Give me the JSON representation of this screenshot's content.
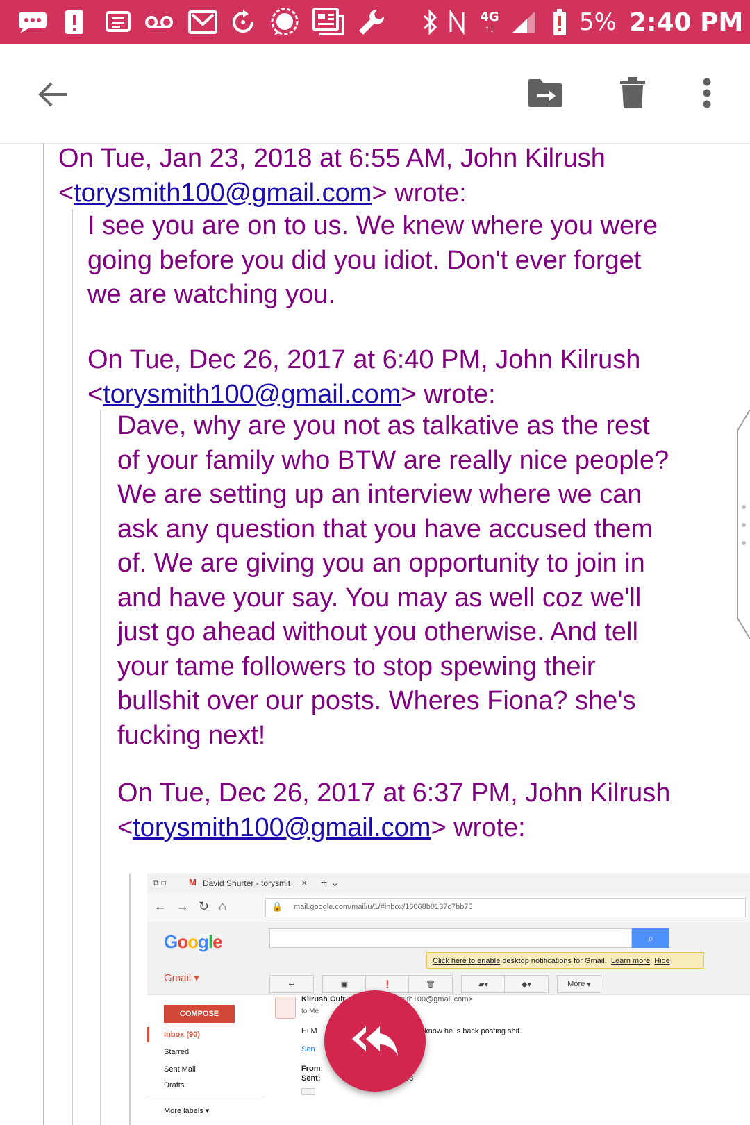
{
  "status_bar": {
    "battery_percent": "5%",
    "time": "2:40 PM",
    "network": "4G",
    "network_sub": "LTE",
    "background_color": "#d2335c",
    "left_icons": [
      "chat-bubble-icon",
      "alert-icon",
      "message-icon",
      "voicemail-icon",
      "gmail-icon",
      "sync-icon",
      "signal-app-icon",
      "news-icon",
      "wrench-icon"
    ],
    "right_icons": [
      "bluetooth-icon",
      "nfc-icon",
      "network-4g-icon",
      "cell-signal-icon",
      "battery-alert-icon"
    ]
  },
  "app_bar": {
    "actions": [
      "back-arrow-icon",
      "move-to-folder-icon",
      "delete-icon",
      "more-vert-icon"
    ]
  },
  "message": {
    "text_color": "#800080",
    "link_color": "#1a0dab",
    "q1": {
      "line1": "On Tue, Jan 23, 2018 at 6:55 AM, John Kilrush",
      "email": "torysmith100@gmail.com",
      "wrote": "wrote:"
    },
    "q1_body": {
      "line1": "I see you are on to us. We knew where you were",
      "line2": "going before you did you idiot. Don't ever forget",
      "line3": "we are watching you."
    },
    "q2": {
      "line1": "On Tue, Dec 26, 2017 at 6:40 PM, John Kilrush",
      "email": "torysmith100@gmail.com",
      "wrote": "wrote:"
    },
    "q2_body": {
      "line1": "Dave, why are you not as talkative as the rest",
      "line2": "of your family who BTW are really nice people?",
      "line3": "We are setting up an interview where we can",
      "line4": "ask any question that you have accused them",
      "line5": "of. We are giving you an opportunity to join in",
      "line6": "and have your say. You may as well coz we'll",
      "line7": "just go ahead without you otherwise. And tell",
      "line8": "your tame followers to stop spewing their",
      "line9": "bullshit over our posts. Wheres Fiona? she's",
      "line10": "fucking next!"
    },
    "q3": {
      "line1": "On Tue, Dec 26, 2017 at 6:37 PM, John Kilrush",
      "email": "torysmith100@gmail.com",
      "wrote": "wrote:"
    }
  },
  "embedded_screenshot": {
    "tab_title": "David Shurter - torysmit",
    "url": "mail.google.com/mail/u/1/#inbox/16068b0137c7bb75",
    "logo": "Google",
    "gmail_label": "Gmail",
    "notification": {
      "link": "Click here to enable",
      "text": "desktop notifications for Gmail.",
      "learn_more": "Learn more",
      "hide": "Hide"
    },
    "compose": "COMPOSE",
    "nav": [
      "Inbox (90)",
      "Starred",
      "Sent Mail",
      "Drafts"
    ],
    "more_labels": "More labels",
    "toolbar_more": "More",
    "sender_name": "Kilrush Guit",
    "sender_email": "mith100@gmail.com>",
    "to_line": "to Me",
    "body_start": "Hi M",
    "body_end": "u know he is back posting shit.",
    "sent_short": "Sen",
    "from_label": "From",
    "sent_label": "Sent:",
    "sent_time_frag": ":53"
  },
  "fab": {
    "icon": "reply-all-icon",
    "color": "#d3264f"
  }
}
